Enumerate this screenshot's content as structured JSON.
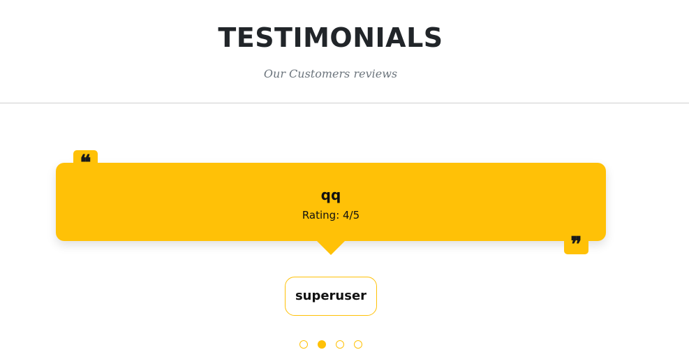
{
  "section": {
    "title": "TESTIMONIALS",
    "subtitle": "Our Customers reviews"
  },
  "testimonial": {
    "title": "qq",
    "rating_text": "Rating: 4/5",
    "author": "superuser",
    "quote_open_icon": "❝",
    "quote_close_icon": "❞"
  },
  "carousel": {
    "total_slides": 4,
    "active_index": 1
  },
  "colors": {
    "accent": "#ffc107",
    "heading": "#212529",
    "muted": "#6c757d"
  }
}
